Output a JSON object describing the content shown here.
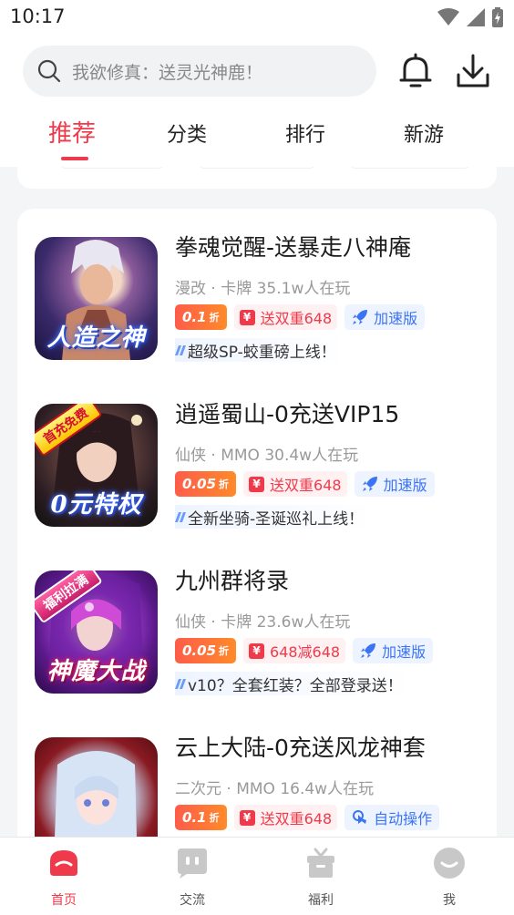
{
  "status": {
    "time": "10:17"
  },
  "search": {
    "placeholder": "我欲修真：送灵光神鹿！"
  },
  "tabs": [
    {
      "label": "推荐",
      "active": true
    },
    {
      "label": "分类",
      "active": false
    },
    {
      "label": "排行",
      "active": false
    },
    {
      "label": "新游",
      "active": false
    }
  ],
  "games": [
    {
      "title": "拳魂觉醒-送暴走八神庵",
      "meta": "漫改 · 卡牌  35.1w人在玩",
      "discount": "0.1",
      "discount_unit": "折",
      "gift": "送双重648",
      "speed": "加速版",
      "notice": "超级SP-蛟重磅上线！",
      "thumb_label": "人造之神",
      "thumb_badge": ""
    },
    {
      "title": "逍遥蜀山-0充送VIP15",
      "meta": "仙侠 · MMO  30.4w人在玩",
      "discount": "0.05",
      "discount_unit": "折",
      "gift": "送双重648",
      "speed": "加速版",
      "notice": "全新坐骑-圣诞巡礼上线！",
      "thumb_label": "0元特权",
      "thumb_badge": "首充免费"
    },
    {
      "title": "九州群将录",
      "meta": "仙侠 · 卡牌  23.6w人在玩",
      "discount": "0.05",
      "discount_unit": "折",
      "gift": "648减648",
      "speed": "加速版",
      "notice": "v10？全套红装？全部登录送！",
      "thumb_label": "神魔大战",
      "thumb_badge": "福利拉满"
    },
    {
      "title": "云上大陆-0充送风龙神套",
      "meta": "二次元 · MMO  16.4w人在玩",
      "discount": "0.1",
      "discount_unit": "折",
      "gift": "送双重648",
      "speed": "自动操作",
      "notice": "",
      "thumb_label": "",
      "thumb_badge": ""
    }
  ],
  "gift_icon_char": "¥",
  "bottom_nav": [
    {
      "label": "首页",
      "active": true
    },
    {
      "label": "交流",
      "active": false
    },
    {
      "label": "福利",
      "active": false
    },
    {
      "label": "我",
      "active": false
    }
  ],
  "colors": {
    "accent": "#ef3a4b",
    "blue": "#3b73f5"
  }
}
